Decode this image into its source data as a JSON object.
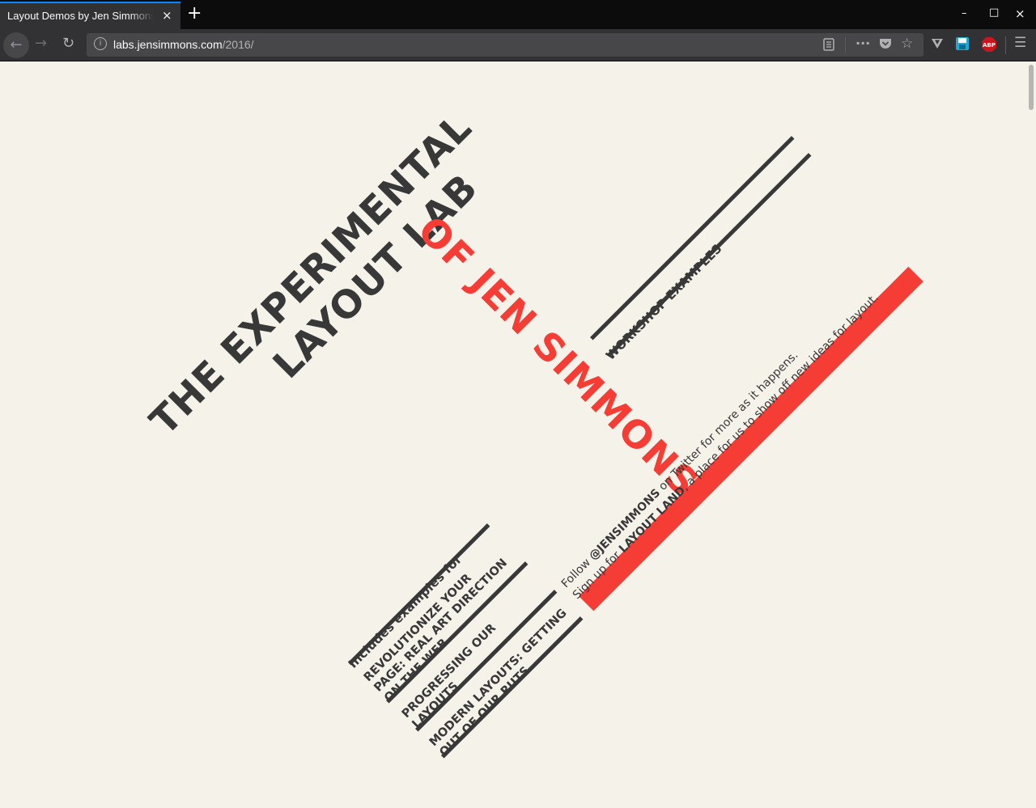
{
  "browser": {
    "tab_title": "Layout Demos by Jen Simmons",
    "tab_close_glyph": "×",
    "new_tab_glyph": "+",
    "window_controls": [
      "–",
      "□",
      "×"
    ],
    "url_host": "labs.jensimmons.com",
    "url_path": "/2016/",
    "icons": [
      "back-icon",
      "forward-icon",
      "reload-icon",
      "site-info-icon",
      "reader-view-icon",
      "page-actions-icon",
      "pocket-icon",
      "bookmark-star-icon",
      "vivaldi-extension-icon",
      "save-extension-icon",
      "adblock-plus-icon",
      "menu-icon"
    ],
    "adblock_label": "ABP"
  },
  "page": {
    "title_line1": "THE EXPERIMENTAL",
    "title_line2": "LAYOUT LAB",
    "title_line3": "OF JEN SIMMONS",
    "workshop_link": "WORKSHOP EXAMPLES",
    "includes_heading": "Includes examples for",
    "talks": [
      {
        "line1": "REVOLUTIONIZE YOUR",
        "line2": "PAGE: REAL ART DIRECTION",
        "line3": "ON THE WEB"
      },
      {
        "line1": "PROGRESSING OUR",
        "line2": "LAYOUTS"
      },
      {
        "line1": "MODERN LAYOUTS: GETTING",
        "line2": "OUT OF OUR RUTS"
      }
    ],
    "follow": {
      "prefix": "Follow ",
      "handle": "@JENSIMMONS",
      "suffix": " on Twitter for more as it happens."
    },
    "signup": {
      "prefix": "Sign up for ",
      "link": "LAYOUT LAND",
      "suffix": ", a place for us to show off new ideas for layout."
    },
    "colors": {
      "background": "#f5f2ea",
      "ink": "#383838",
      "accent": "#f53d35"
    }
  }
}
